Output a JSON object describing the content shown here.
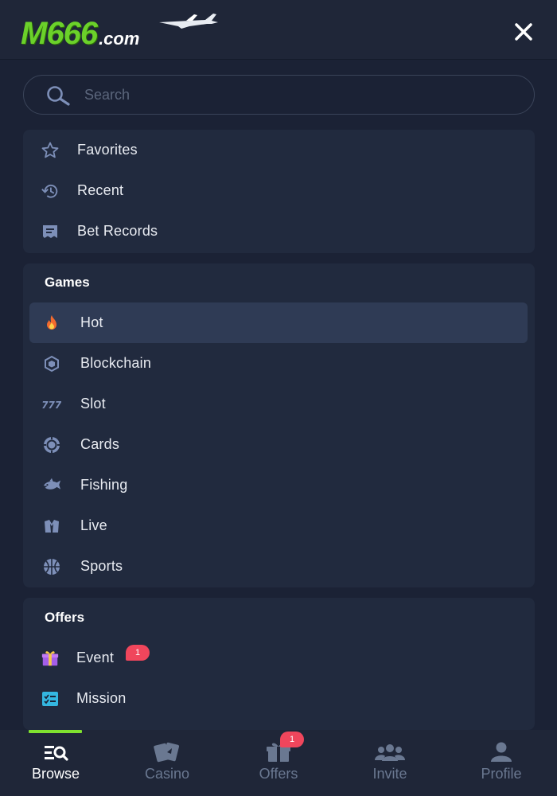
{
  "header": {
    "logo_main": "M666",
    "logo_domain": ".com",
    "close_icon": "close-icon"
  },
  "search": {
    "placeholder": "Search",
    "value": ""
  },
  "quick_links": [
    {
      "label": "Favorites",
      "icon": "star-icon"
    },
    {
      "label": "Recent",
      "icon": "history-icon"
    },
    {
      "label": "Bet Records",
      "icon": "receipt-icon"
    }
  ],
  "games": {
    "title": "Games",
    "items": [
      {
        "label": "Hot",
        "icon": "fire-icon",
        "active": true
      },
      {
        "label": "Blockchain",
        "icon": "cube-icon"
      },
      {
        "label": "Slot",
        "icon": "slot-777-icon"
      },
      {
        "label": "Cards",
        "icon": "poker-chip-icon"
      },
      {
        "label": "Fishing",
        "icon": "fish-icon"
      },
      {
        "label": "Live",
        "icon": "live-dealer-icon"
      },
      {
        "label": "Sports",
        "icon": "basketball-icon"
      }
    ]
  },
  "offers": {
    "title": "Offers",
    "items": [
      {
        "label": "Event",
        "icon": "gift-icon",
        "badge": "1"
      },
      {
        "label": "Mission",
        "icon": "checklist-icon"
      }
    ]
  },
  "bottom_nav": [
    {
      "label": "Browse",
      "icon": "browse-icon",
      "active": true
    },
    {
      "label": "Casino",
      "icon": "cards-icon"
    },
    {
      "label": "Offers",
      "icon": "gift-icon",
      "badge": "1"
    },
    {
      "label": "Invite",
      "icon": "users-icon"
    },
    {
      "label": "Profile",
      "icon": "user-icon"
    }
  ],
  "colors": {
    "background": "#1b2235",
    "panel": "#212a3e",
    "active_row": "#2f3b55",
    "accent_green": "#7fe12f",
    "badge_red": "#f0465c",
    "icon_blue": "#7d8fb8"
  }
}
